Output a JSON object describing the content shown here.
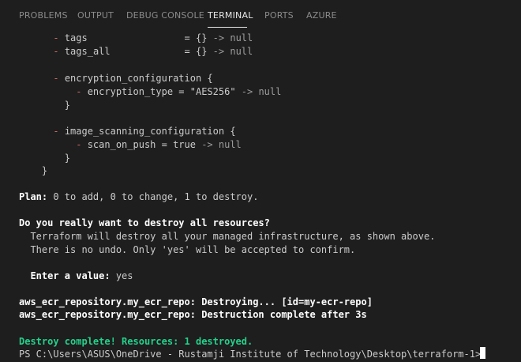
{
  "panel": {
    "tabs": [
      {
        "label": "PROBLEMS",
        "active": false
      },
      {
        "label": "OUTPUT",
        "active": false
      },
      {
        "label": "DEBUG CONSOLE",
        "active": false
      },
      {
        "label": "TERMINAL",
        "active": true
      },
      {
        "label": "PORTS",
        "active": false
      },
      {
        "label": "AZURE",
        "active": false
      }
    ]
  },
  "terminal": {
    "lines": [
      {
        "segments": [
          {
            "text": "      "
          },
          {
            "text": "-",
            "style": "minus"
          },
          {
            "text": " tags                 = {} "
          },
          {
            "text": "-> null",
            "style": "gray"
          }
        ]
      },
      {
        "segments": [
          {
            "text": "      "
          },
          {
            "text": "-",
            "style": "minus"
          },
          {
            "text": " tags_all             = {} "
          },
          {
            "text": "-> null",
            "style": "gray"
          }
        ]
      },
      {
        "segments": [
          {
            "text": ""
          }
        ]
      },
      {
        "segments": [
          {
            "text": "      "
          },
          {
            "text": "-",
            "style": "minus"
          },
          {
            "text": " encryption_configuration {"
          }
        ]
      },
      {
        "segments": [
          {
            "text": "          "
          },
          {
            "text": "-",
            "style": "minus"
          },
          {
            "text": " encryption_type = \"AES256\" "
          },
          {
            "text": "-> null",
            "style": "gray"
          }
        ]
      },
      {
        "segments": [
          {
            "text": "        }"
          }
        ]
      },
      {
        "segments": [
          {
            "text": ""
          }
        ]
      },
      {
        "segments": [
          {
            "text": "      "
          },
          {
            "text": "-",
            "style": "minus"
          },
          {
            "text": " image_scanning_configuration {"
          }
        ]
      },
      {
        "segments": [
          {
            "text": "          "
          },
          {
            "text": "-",
            "style": "minus"
          },
          {
            "text": " scan_on_push = true "
          },
          {
            "text": "-> null",
            "style": "gray"
          }
        ]
      },
      {
        "segments": [
          {
            "text": "        }"
          }
        ]
      },
      {
        "segments": [
          {
            "text": "    }"
          }
        ]
      },
      {
        "segments": [
          {
            "text": ""
          }
        ]
      },
      {
        "segments": [
          {
            "text": "Plan:",
            "style": "bold"
          },
          {
            "text": " 0 to add, 0 to change, 1 to destroy."
          }
        ]
      },
      {
        "segments": [
          {
            "text": ""
          }
        ]
      },
      {
        "segments": [
          {
            "text": "Do you really want to destroy all resources?",
            "style": "bold"
          }
        ]
      },
      {
        "segments": [
          {
            "text": "  Terraform will destroy all your managed infrastructure, as shown above."
          }
        ]
      },
      {
        "segments": [
          {
            "text": "  There is no undo. Only 'yes' will be accepted to confirm."
          }
        ]
      },
      {
        "segments": [
          {
            "text": ""
          }
        ]
      },
      {
        "segments": [
          {
            "text": "  Enter a value:",
            "style": "bold"
          },
          {
            "text": " yes"
          }
        ]
      },
      {
        "segments": [
          {
            "text": ""
          }
        ]
      },
      {
        "segments": [
          {
            "text": "aws_ecr_repository.my_ecr_repo: Destroying... [id=my-ecr-repo]",
            "style": "bold"
          }
        ]
      },
      {
        "segments": [
          {
            "text": "aws_ecr_repository.my_ecr_repo: Destruction complete after 3s",
            "style": "bold"
          }
        ]
      },
      {
        "segments": [
          {
            "text": ""
          }
        ]
      },
      {
        "segments": [
          {
            "text": "Destroy complete! Resources: 1 destroyed.",
            "style": "green"
          }
        ]
      },
      {
        "segments": [
          {
            "text": "PS C:\\Users\\ASUS\\OneDrive - Rustamji Institute of Technology\\Desktop\\terraform-1> "
          }
        ]
      }
    ]
  },
  "colors": {
    "background": "#1e1e1e",
    "text": "#cccccc",
    "success": "#23d18b",
    "removed": "#d16969"
  }
}
